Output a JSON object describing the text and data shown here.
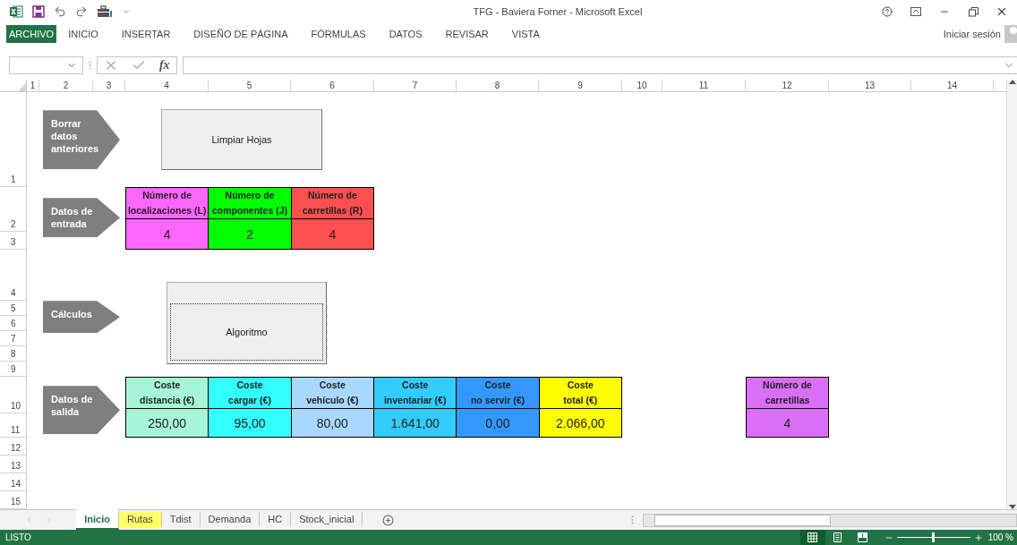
{
  "window": {
    "title": "TFG - Baviera Forner - Microsoft Excel"
  },
  "ribbon": {
    "file_tab": "ARCHIVO",
    "tabs": [
      "INICIO",
      "INSERTAR",
      "DISEÑO DE PÁGINA",
      "FÓRMULAS",
      "DATOS",
      "REVISAR",
      "VISTA"
    ],
    "sign_in": "Iniciar sesión"
  },
  "formula_bar": {
    "function_label": "fx"
  },
  "column_headers": [
    "1",
    "2",
    "3",
    "4",
    "5",
    "6",
    "7",
    "8",
    "9",
    "10",
    "11",
    "12",
    "13",
    "14"
  ],
  "row_headers": [
    "1",
    "2",
    "3",
    "4",
    "5",
    "6",
    "7",
    "8",
    "9",
    "10",
    "11",
    "12",
    "13",
    "14",
    "15"
  ],
  "arrows": [
    {
      "label": "Borrar datos anteriores"
    },
    {
      "label": "Datos de entrada"
    },
    {
      "label": "Cálculos"
    },
    {
      "label": "Datos de salida"
    }
  ],
  "buttons": [
    {
      "label": "Limpiar Hojas",
      "focused": false
    },
    {
      "label": "Algoritmo",
      "focused": true
    }
  ],
  "input_table": [
    {
      "header": "Número de\nlocalizaciones (L)",
      "value": "4",
      "color": "#ff66ff"
    },
    {
      "header": "Número de\ncomponentes (J)",
      "value": "2",
      "color": "#00ff00"
    },
    {
      "header": "Número de\ncarretillas (R)",
      "value": "4",
      "color": "#ff5050"
    }
  ],
  "output_table": [
    {
      "header": "Coste\ndistancia (€)",
      "value": "250,00",
      "color": "#a6f5d6"
    },
    {
      "header": "Coste\ncargar (€)",
      "value": "95,00",
      "color": "#33ffff"
    },
    {
      "header": "Coste\nvehículo (€)",
      "value": "80,00",
      "color": "#a8d8ff"
    },
    {
      "header": "Coste\ninventariar (€)",
      "value": "1.641,00",
      "color": "#33ccff"
    },
    {
      "header": "Coste\nno servir (€)",
      "value": "0,00",
      "color": "#3399ff"
    },
    {
      "header": "Coste\ntotal (€)",
      "value": "2.066,00",
      "color": "#ffff00"
    }
  ],
  "trucks_table": {
    "header": "Número de\ncarretillas",
    "value": "4",
    "color": "#da6ef7"
  },
  "sheet_tabs": [
    {
      "label": "Inicio",
      "selected": true
    },
    {
      "label": "Rutas",
      "selected": false,
      "color": "#ffff66"
    },
    {
      "label": "Tdist",
      "selected": false
    },
    {
      "label": "Demanda",
      "selected": false
    },
    {
      "label": "HC",
      "selected": false
    },
    {
      "label": "Stock_inicial",
      "selected": false
    }
  ],
  "status_bar": {
    "status": "LISTO",
    "zoom": "100 %",
    "zoom_slider": {
      "level": 0.5
    }
  }
}
